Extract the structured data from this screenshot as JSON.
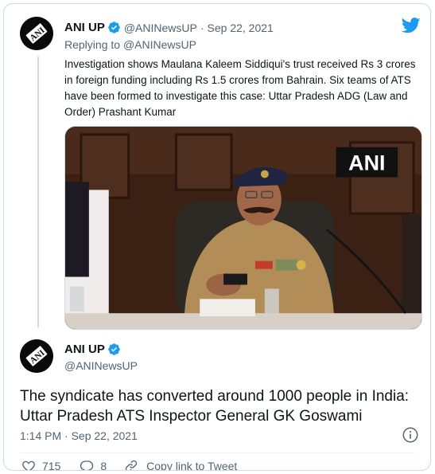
{
  "parent_tweet": {
    "author_name": "ANI UP",
    "handle": "@ANINewsUP",
    "separator": "·",
    "date": "Sep 22, 2021",
    "replying_prefix": "Replying to ",
    "replying_to": "@ANINewsUP",
    "text": "Investigation shows Maulana Kaleem Siddiqui's trust received Rs 3 crores in foreign funding including Rs 1.5 crores from Bahrain. Six teams of ATS have been formed to investigate this case: Uttar Pradesh ADG (Law and Order) Prashant Kumar",
    "media_watermark": "ANI",
    "avatar_logo_text": "ANI"
  },
  "main_tweet": {
    "author_name": "ANI UP",
    "handle": "@ANINewsUP",
    "text": "The syndicate has converted around 1000 people in India: Uttar Pradesh ATS Inspector General GK Goswami",
    "timestamp": "1:14 PM · Sep 22, 2021",
    "like_count": "715",
    "reply_count": "8",
    "copy_link_label": "Copy link to Tweet"
  },
  "colors": {
    "verified_blue": "#1d9bf0",
    "twitter_blue": "#1d9bf0",
    "secondary_text": "#536471",
    "border": "#cfd9de"
  },
  "icons": [
    "twitter-bird-icon",
    "verified-badge-icon",
    "info-icon",
    "heart-icon",
    "reply-icon",
    "link-icon"
  ]
}
